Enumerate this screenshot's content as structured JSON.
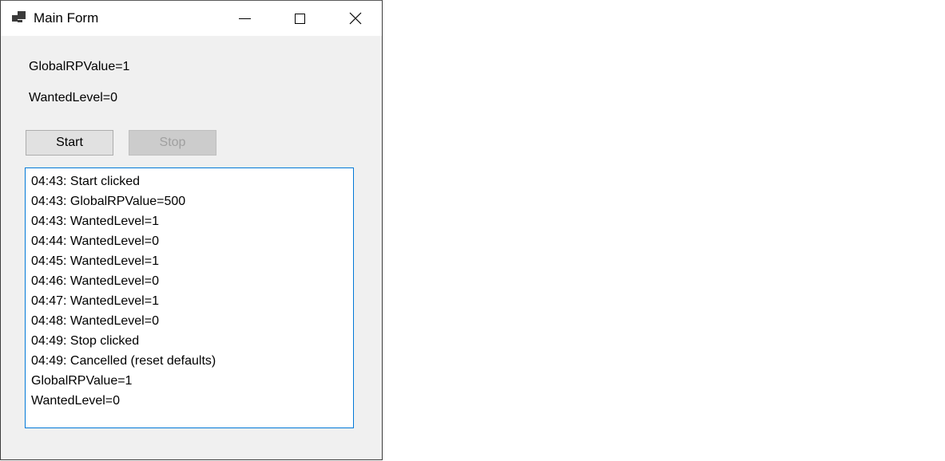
{
  "window": {
    "title": "Main Form",
    "app_icon": "windows-form-icon",
    "controls": {
      "minimize": "minimize-icon",
      "maximize": "maximize-icon",
      "close": "close-icon"
    }
  },
  "labels": {
    "global_rp": "GlobalRPValue=1",
    "wanted_level": "WantedLevel=0"
  },
  "buttons": {
    "start": "Start",
    "stop": "Stop",
    "stop_enabled": false
  },
  "log": {
    "lines": [
      "04:43: Start clicked",
      "04:43: GlobalRPValue=500",
      "04:43: WantedLevel=1",
      "04:44: WantedLevel=0",
      "04:45: WantedLevel=1",
      "04:46: WantedLevel=0",
      "04:47: WantedLevel=1",
      "04:48: WantedLevel=0",
      "04:49: Stop clicked",
      "04:49: Cancelled (reset defaults)",
      "GlobalRPValue=1",
      "WantedLevel=0"
    ]
  }
}
